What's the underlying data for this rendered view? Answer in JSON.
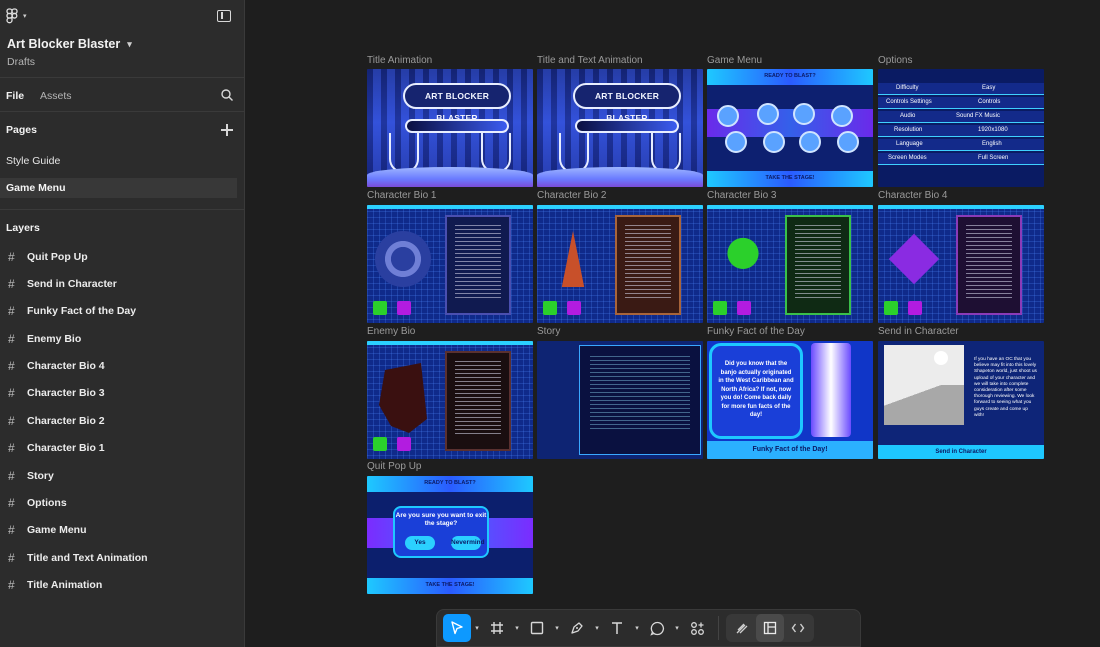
{
  "sidebar": {
    "file_title": "Art Blocker Blaster",
    "file_location": "Drafts",
    "tabs": {
      "file": "File",
      "assets": "Assets"
    },
    "pages_heading": "Pages",
    "pages": [
      {
        "label": "Style Guide",
        "selected": false
      },
      {
        "label": "Game Menu",
        "selected": true
      }
    ],
    "layers_heading": "Layers",
    "layers": [
      "Quit Pop Up",
      "Send in Character",
      "Funky Fact of the Day",
      "Enemy Bio",
      "Character Bio 4",
      "Character Bio 3",
      "Character Bio 2",
      "Character Bio 1",
      "Story",
      "Options",
      "Game Menu",
      "Title and Text Animation",
      "Title Animation"
    ]
  },
  "canvas": {
    "frame_labels": {
      "title_animation": "Title Animation",
      "title_text_animation": "Title and Text Animation",
      "game_menu": "Game Menu",
      "options": "Options",
      "char_bio_1": "Character Bio 1",
      "char_bio_2": "Character Bio 2",
      "char_bio_3": "Character Bio 3",
      "char_bio_4": "Character Bio 4",
      "enemy_bio": "Enemy Bio",
      "story": "Story",
      "funky_fact": "Funky Fact of the Day",
      "send_in_character": "Send in Character",
      "quit_pop_up": "Quit Pop Up"
    },
    "title_pill": "ART BLOCKER BLASTER",
    "game_menu_header": "READY TO BLAST?",
    "game_menu_footer": "TAKE THE STAGE!",
    "options_rows": [
      {
        "label": "Difficulty",
        "value": "Easy"
      },
      {
        "label": "Controls Settings",
        "value": "Controls"
      },
      {
        "label": "Audio",
        "value": "Sound FX   Music"
      },
      {
        "label": "Resolution",
        "value": "1920x1080"
      },
      {
        "label": "Language",
        "value": "English"
      },
      {
        "label": "Screen Modes",
        "value": "Full Screen"
      }
    ],
    "funky_fact_text": "Did you know that the banjo actually originated in the West Caribbean and North Africa? If not, now you do! Come back daily for more fun facts of the day!",
    "funky_fact_footer": "Funky Fact of the Day!",
    "send_in_text": "If you have an OC that you believe may fit into this lovely Shapeton world, just shoot us upload of your character and we will take into complete consideration after some thorough reviewing. We look forward to seeing what you guys create and come up with!",
    "send_in_footer": "Send in Character",
    "quit_dialog_text": "Are you sure you want to exit the stage?",
    "quit_yes": "Yes",
    "quit_no": "Nevermind",
    "quit_header": "READY TO BLAST?",
    "quit_footer": "TAKE THE STAGE!"
  },
  "toolbar": {
    "tools": [
      "move-tool",
      "frame-tool",
      "shape-tool",
      "pen-tool",
      "text-tool",
      "comment-tool",
      "actions-tool",
      "draw-mode",
      "design-mode",
      "dev-mode"
    ],
    "active_tool": "move-tool",
    "accent": "#0d99ff"
  }
}
